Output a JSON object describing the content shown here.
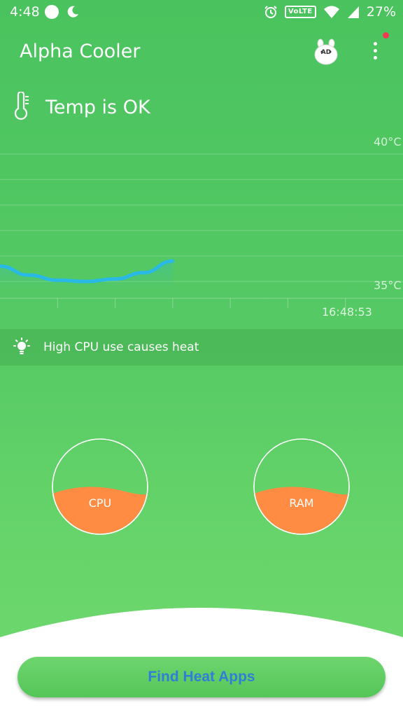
{
  "status_bar": {
    "time": "4:48",
    "network_badge": "VoLTE",
    "battery_percent": "27%"
  },
  "app": {
    "title": "Alpha Cooler",
    "ad_badge": "AD"
  },
  "temperature": {
    "status_text": "Temp is OK"
  },
  "chart_data": {
    "type": "line",
    "title": "",
    "xlabel": "",
    "ylabel": "",
    "y_tick_labels": [
      "40°C",
      "35°C"
    ],
    "ylim": [
      35,
      40
    ],
    "x_label_last": "16:48:53",
    "series": [
      {
        "x": [
          0,
          0.5,
          1.0,
          1.5,
          2.0,
          2.5,
          3.0
        ],
        "values": [
          35.6,
          35.25,
          35.05,
          35.0,
          35.1,
          35.35,
          35.8
        ]
      }
    ],
    "xlim": [
      0,
      7
    ],
    "grid": true,
    "line_color": "#29b9e6"
  },
  "tip": {
    "text": "High CPU use causes heat"
  },
  "gauges": {
    "cpu": {
      "label": "CPU",
      "level": 0.45
    },
    "ram": {
      "label": "RAM",
      "level": 0.45
    },
    "fill_color": "#ff8c42"
  },
  "action": {
    "find_button_label": "Find Heat Apps"
  },
  "colors": {
    "background_top": "#4ac35e",
    "background_bottom": "#6fd96e",
    "notification_dot": "#f2394f",
    "button_text": "#2f7fd9"
  }
}
